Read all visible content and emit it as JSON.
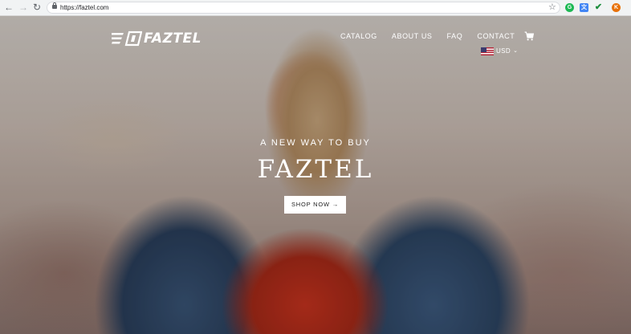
{
  "browser": {
    "url": "https://faztel.com",
    "icons": [
      "back-icon",
      "forward-icon",
      "reload-icon",
      "lock-icon",
      "star-icon",
      "grammarly-icon",
      "translate-icon",
      "check-icon",
      "avatar"
    ],
    "avatar_letter": "K"
  },
  "header": {
    "logo_text": "FAZTEL",
    "nav": [
      "CATALOG",
      "ABOUT US",
      "FAQ",
      "CONTACT"
    ],
    "currency": "USD"
  },
  "hero": {
    "tagline": "A NEW WAY TO BUY",
    "title": "FAZTEL",
    "button_label": "SHOP NOW →"
  },
  "colors": {
    "chrome_bg": "#f1f3f4",
    "text_on_hero": "#ffffff",
    "button_bg": "#ffffff"
  }
}
